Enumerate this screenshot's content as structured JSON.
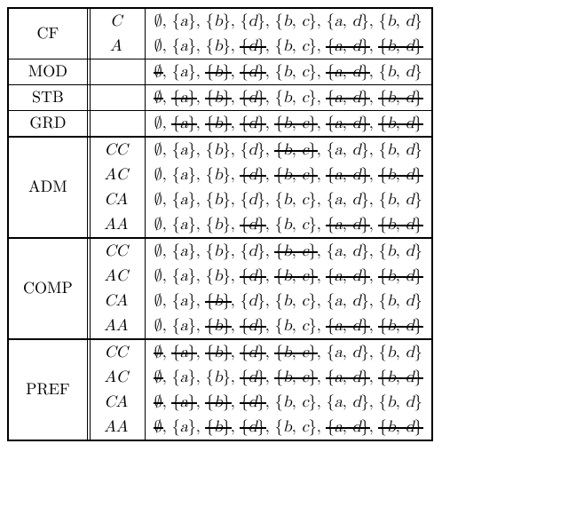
{
  "groups": [
    {
      "label": "CF",
      "rows": [
        {
          "subtype": "C",
          "sets": [
            {
              "t": "∅",
              "s": false
            },
            {
              "t": "{a}",
              "s": false
            },
            {
              "t": "{b}",
              "s": false
            },
            {
              "t": "{d}",
              "s": false
            },
            {
              "t": "{b, c}",
              "s": false
            },
            {
              "t": "{a, d}",
              "s": false
            },
            {
              "t": "{b, d}",
              "s": false
            }
          ]
        },
        {
          "subtype": "A",
          "sets": [
            {
              "t": "∅",
              "s": false
            },
            {
              "t": "{a}",
              "s": false
            },
            {
              "t": "{b}",
              "s": false
            },
            {
              "t": "{d}",
              "s": true
            },
            {
              "t": "{b, c}",
              "s": false
            },
            {
              "t": "{a, d}",
              "s": true
            },
            {
              "t": "{b, d}",
              "s": true
            }
          ]
        }
      ]
    },
    {
      "label": "MOD",
      "rows": [
        {
          "subtype": "",
          "sets": [
            {
              "t": "∅",
              "s": true
            },
            {
              "t": "{a}",
              "s": false
            },
            {
              "t": "{b}",
              "s": true
            },
            {
              "t": "{d}",
              "s": true
            },
            {
              "t": "{b, c}",
              "s": false
            },
            {
              "t": "{a, d}",
              "s": true
            },
            {
              "t": "{b, d}",
              "s": false
            }
          ]
        }
      ]
    },
    {
      "label": "STB",
      "rows": [
        {
          "subtype": "",
          "sets": [
            {
              "t": "∅",
              "s": true
            },
            {
              "t": "{a}",
              "s": true
            },
            {
              "t": "{b}",
              "s": true
            },
            {
              "t": "{d}",
              "s": true
            },
            {
              "t": "{b, c}",
              "s": false
            },
            {
              "t": "{a, d}",
              "s": true
            },
            {
              "t": "{b, d}",
              "s": true
            }
          ]
        }
      ]
    },
    {
      "label": "GRD",
      "rows": [
        {
          "subtype": "",
          "sets": [
            {
              "t": "∅",
              "s": false
            },
            {
              "t": "{a}",
              "s": true
            },
            {
              "t": "{b}",
              "s": true
            },
            {
              "t": "{d}",
              "s": true
            },
            {
              "t": "{b, c}",
              "s": true
            },
            {
              "t": "{a, d}",
              "s": true
            },
            {
              "t": "{b, d}",
              "s": true
            }
          ]
        }
      ]
    },
    {
      "label": "ADM",
      "rows": [
        {
          "subtype": "CC",
          "sets": [
            {
              "t": "∅",
              "s": false
            },
            {
              "t": "{a}",
              "s": false
            },
            {
              "t": "{b}",
              "s": false
            },
            {
              "t": "{d}",
              "s": false
            },
            {
              "t": "{b, c}",
              "s": true
            },
            {
              "t": "{a, d}",
              "s": false
            },
            {
              "t": "{b, d}",
              "s": false
            }
          ]
        },
        {
          "subtype": "AC",
          "sets": [
            {
              "t": "∅",
              "s": false
            },
            {
              "t": "{a}",
              "s": false
            },
            {
              "t": "{b}",
              "s": false
            },
            {
              "t": "{d}",
              "s": true
            },
            {
              "t": "{b, c}",
              "s": true
            },
            {
              "t": "{a, d}",
              "s": true
            },
            {
              "t": "{b, d}",
              "s": true
            }
          ]
        },
        {
          "subtype": "CA",
          "sets": [
            {
              "t": "∅",
              "s": false
            },
            {
              "t": "{a}",
              "s": false
            },
            {
              "t": "{b}",
              "s": false
            },
            {
              "t": "{d}",
              "s": false
            },
            {
              "t": "{b, c}",
              "s": false
            },
            {
              "t": "{a, d}",
              "s": false
            },
            {
              "t": "{b, d}",
              "s": false
            }
          ]
        },
        {
          "subtype": "AA",
          "sets": [
            {
              "t": "∅",
              "s": false
            },
            {
              "t": "{a}",
              "s": false
            },
            {
              "t": "{b}",
              "s": false
            },
            {
              "t": "{d}",
              "s": true
            },
            {
              "t": "{b, c}",
              "s": false
            },
            {
              "t": "{a, d}",
              "s": true
            },
            {
              "t": "{b, d}",
              "s": true
            }
          ]
        }
      ]
    },
    {
      "label": "COMP",
      "rows": [
        {
          "subtype": "CC",
          "sets": [
            {
              "t": "∅",
              "s": false
            },
            {
              "t": "{a}",
              "s": false
            },
            {
              "t": "{b}",
              "s": false
            },
            {
              "t": "{d}",
              "s": false
            },
            {
              "t": "{b, c}",
              "s": true
            },
            {
              "t": "{a, d}",
              "s": false
            },
            {
              "t": "{b, d}",
              "s": false
            }
          ]
        },
        {
          "subtype": "AC",
          "sets": [
            {
              "t": "∅",
              "s": false
            },
            {
              "t": "{a}",
              "s": false
            },
            {
              "t": "{b}",
              "s": false
            },
            {
              "t": "{d}",
              "s": true
            },
            {
              "t": "{b, c}",
              "s": true
            },
            {
              "t": "{a, d}",
              "s": true
            },
            {
              "t": "{b, d}",
              "s": true
            }
          ]
        },
        {
          "subtype": "CA",
          "sets": [
            {
              "t": "∅",
              "s": false
            },
            {
              "t": "{a}",
              "s": false
            },
            {
              "t": "{b}",
              "s": true
            },
            {
              "t": "{d}",
              "s": false
            },
            {
              "t": "{b, c}",
              "s": false
            },
            {
              "t": "{a, d}",
              "s": false
            },
            {
              "t": "{b, d}",
              "s": false
            }
          ]
        },
        {
          "subtype": "AA",
          "sets": [
            {
              "t": "∅",
              "s": false
            },
            {
              "t": "{a}",
              "s": false
            },
            {
              "t": "{b}",
              "s": true
            },
            {
              "t": "{d}",
              "s": true
            },
            {
              "t": "{b, c}",
              "s": false
            },
            {
              "t": "{a, d}",
              "s": true
            },
            {
              "t": "{b, d}",
              "s": true
            }
          ]
        }
      ]
    },
    {
      "label": "PREF",
      "rows": [
        {
          "subtype": "CC",
          "sets": [
            {
              "t": "∅",
              "s": true
            },
            {
              "t": "{a}",
              "s": true
            },
            {
              "t": "{b}",
              "s": true
            },
            {
              "t": "{d}",
              "s": true
            },
            {
              "t": "{b, c}",
              "s": true
            },
            {
              "t": "{a, d}",
              "s": false
            },
            {
              "t": "{b, d}",
              "s": false
            }
          ]
        },
        {
          "subtype": "AC",
          "sets": [
            {
              "t": "∅",
              "s": true
            },
            {
              "t": "{a}",
              "s": false
            },
            {
              "t": "{b}",
              "s": false
            },
            {
              "t": "{d}",
              "s": true
            },
            {
              "t": "{b, c}",
              "s": true
            },
            {
              "t": "{a, d}",
              "s": true
            },
            {
              "t": "{b, d}",
              "s": true
            }
          ]
        },
        {
          "subtype": "CA",
          "sets": [
            {
              "t": "∅",
              "s": true
            },
            {
              "t": "{a}",
              "s": true
            },
            {
              "t": "{b}",
              "s": true
            },
            {
              "t": "{d}",
              "s": true
            },
            {
              "t": "{b, c}",
              "s": false
            },
            {
              "t": "{a, d}",
              "s": false
            },
            {
              "t": "{b, d}",
              "s": false
            }
          ]
        },
        {
          "subtype": "AA",
          "sets": [
            {
              "t": "∅",
              "s": true
            },
            {
              "t": "{a}",
              "s": false
            },
            {
              "t": "{b}",
              "s": true
            },
            {
              "t": "{d}",
              "s": true
            },
            {
              "t": "{b, c}",
              "s": false
            },
            {
              "t": "{a, d}",
              "s": true
            },
            {
              "t": "{b, d}",
              "s": true
            }
          ]
        }
      ]
    }
  ]
}
